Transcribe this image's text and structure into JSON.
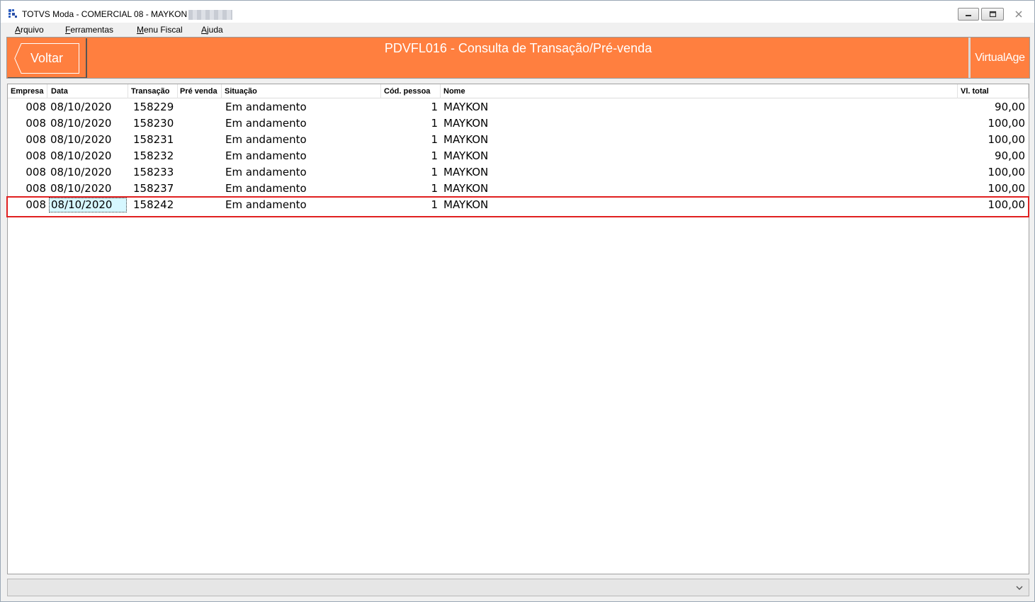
{
  "window": {
    "title": "TOTVS Moda - COMERCIAL 08 - MAYKON",
    "icons": [
      "app-icon",
      "minimize-icon",
      "maximize-icon",
      "close-icon"
    ]
  },
  "menu": {
    "items": [
      "Arquivo",
      "Ferramentas",
      "Menu Fiscal",
      "Ajuda"
    ]
  },
  "header": {
    "back_label": "Voltar",
    "title": "PDVFL016 - Consulta de Transação/Pré-venda",
    "brand_label": "VirtualAge",
    "accent_color": "#ff7f3f"
  },
  "grid": {
    "columns": [
      "Empresa",
      "Data",
      "Transação",
      "Pré venda",
      "Situação",
      "Cód. pessoa",
      "Nome",
      "Vl. total"
    ],
    "rows": [
      {
        "empresa": "008",
        "data": "08/10/2020",
        "transacao": "158229",
        "pre_venda": "",
        "situacao": "Em andamento",
        "cod_pessoa": "1",
        "nome": "MAYKON",
        "vl_total": "90,00"
      },
      {
        "empresa": "008",
        "data": "08/10/2020",
        "transacao": "158230",
        "pre_venda": "",
        "situacao": "Em andamento",
        "cod_pessoa": "1",
        "nome": "MAYKON",
        "vl_total": "100,00"
      },
      {
        "empresa": "008",
        "data": "08/10/2020",
        "transacao": "158231",
        "pre_venda": "",
        "situacao": "Em andamento",
        "cod_pessoa": "1",
        "nome": "MAYKON",
        "vl_total": "100,00"
      },
      {
        "empresa": "008",
        "data": "08/10/2020",
        "transacao": "158232",
        "pre_venda": "",
        "situacao": "Em andamento",
        "cod_pessoa": "1",
        "nome": "MAYKON",
        "vl_total": "90,00"
      },
      {
        "empresa": "008",
        "data": "08/10/2020",
        "transacao": "158233",
        "pre_venda": "",
        "situacao": "Em andamento",
        "cod_pessoa": "1",
        "nome": "MAYKON",
        "vl_total": "100,00"
      },
      {
        "empresa": "008",
        "data": "08/10/2020",
        "transacao": "158237",
        "pre_venda": "",
        "situacao": "Em andamento",
        "cod_pessoa": "1",
        "nome": "MAYKON",
        "vl_total": "100,00"
      },
      {
        "empresa": "008",
        "data": "08/10/2020",
        "transacao": "158242",
        "pre_venda": "",
        "situacao": "Em andamento",
        "cod_pessoa": "1",
        "nome": "MAYKON",
        "vl_total": "100,00"
      }
    ],
    "selected_row_index": 6,
    "highlight_color": "#e02020"
  },
  "statusbar": {
    "icon": "chevron-down-icon"
  }
}
